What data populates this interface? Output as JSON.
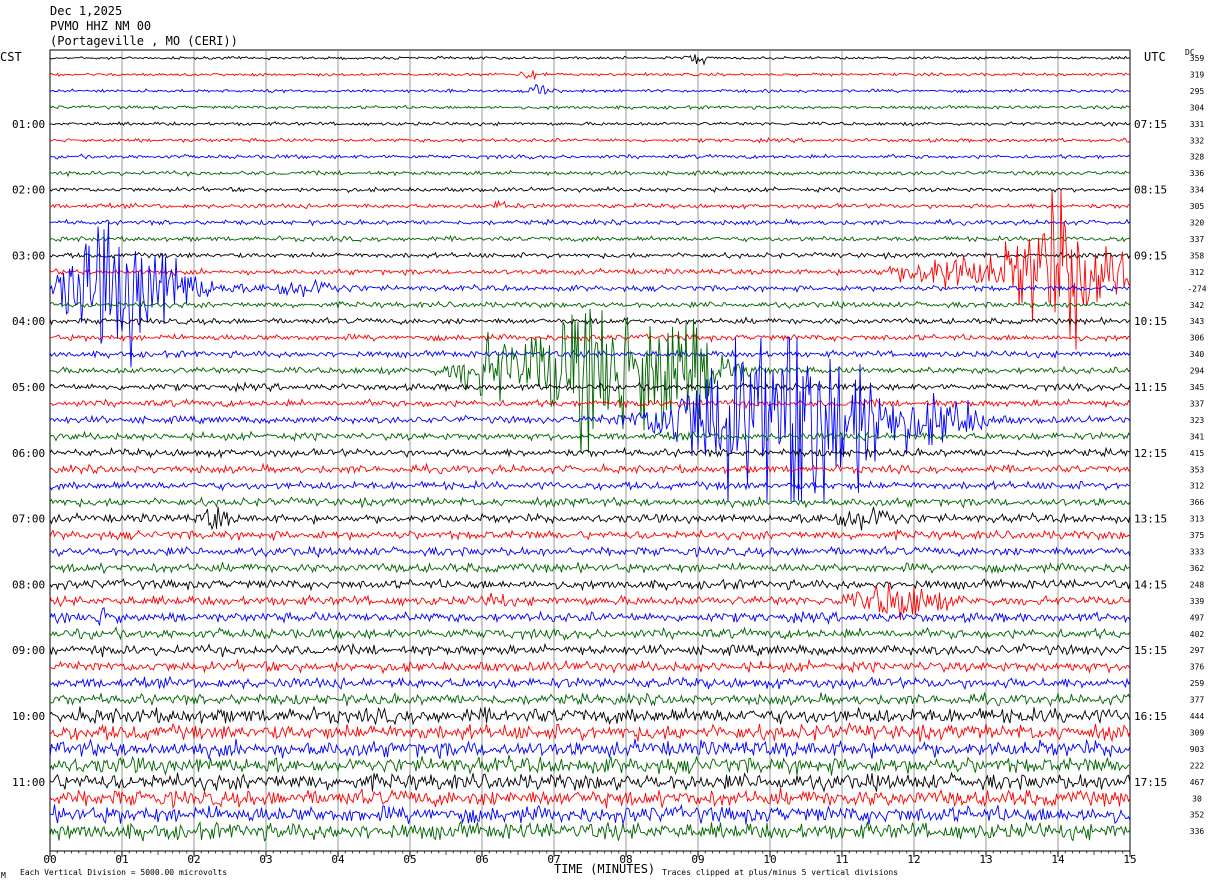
{
  "header": {
    "date": "Dec 1,2025",
    "station": "PVMO HHZ NM 00",
    "location": "(Portageville , MO (CERI))"
  },
  "chart_data": {
    "type": "line",
    "title": "",
    "left_tz": "CST",
    "right_tz": "UTC",
    "dc_label": "DC",
    "xlabel": "TIME (MINUTES)",
    "x_ticks": [
      "00",
      "01",
      "02",
      "03",
      "04",
      "05",
      "06",
      "07",
      "08",
      "09",
      "10",
      "11",
      "12",
      "13",
      "14",
      "15"
    ],
    "xlim": [
      0,
      15
    ],
    "trace_count": 48,
    "traces_per_hour": 4,
    "trace_colors": [
      "#000000",
      "#ff0000",
      "#0000ff",
      "#006400"
    ],
    "left_hour_labels": [
      "01:00",
      "02:00",
      "03:00",
      "04:00",
      "05:00",
      "06:00",
      "07:00",
      "08:00",
      "09:00",
      "10:00",
      "11:00"
    ],
    "right_hour_labels": [
      "07:15",
      "08:15",
      "09:15",
      "10:15",
      "11:15",
      "12:15",
      "13:15",
      "14:15",
      "15:15",
      "16:15",
      "17:15"
    ],
    "dc_offsets": [
      "359",
      "319",
      "295",
      "304",
      "331",
      "332",
      "328",
      "336",
      "334",
      "305",
      "320",
      "337",
      "358",
      "312",
      "-274",
      "342",
      "343",
      "306",
      "340",
      "294",
      "345",
      "337",
      "323",
      "341",
      "415",
      "353",
      "312",
      "366",
      "313",
      "375",
      "333",
      "362",
      "248",
      "339",
      "497",
      "402",
      "297",
      "376",
      "259",
      "377",
      "444",
      "309",
      "903",
      "222",
      "467",
      "30",
      "352",
      "336"
    ],
    "footer_left": "Each Vertical Division = 5000.00 microvolts",
    "footer_right": "Traces clipped at plus/minus 5 vertical divisions",
    "corner_mark": "M"
  }
}
